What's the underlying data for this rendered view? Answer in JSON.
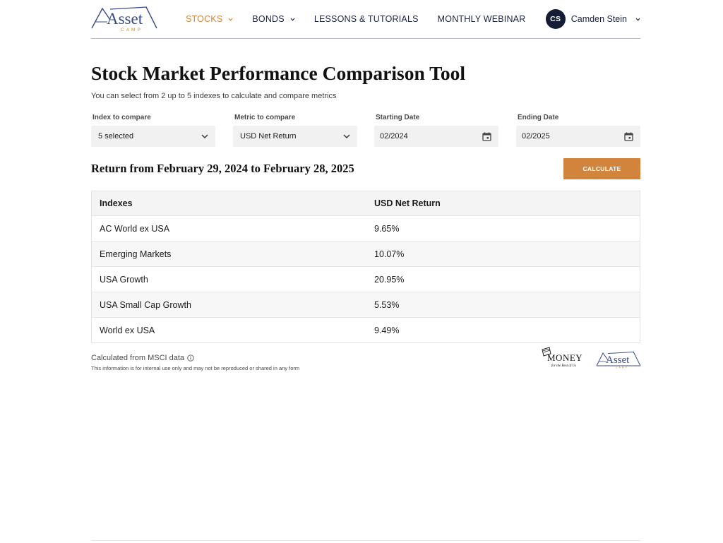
{
  "brand": {
    "logo_text": "Asset",
    "logo_sub": "CAMP",
    "color_primary": "#3a4a8a",
    "color_accent": "#d2843c"
  },
  "nav": {
    "items": [
      {
        "label": "STOCKS",
        "active": true,
        "has_menu": true
      },
      {
        "label": "BONDS",
        "active": false,
        "has_menu": true
      },
      {
        "label": "LESSONS & TUTORIALS",
        "active": false,
        "has_menu": false
      },
      {
        "label": "MONTHLY WEBINAR",
        "active": false,
        "has_menu": false
      }
    ]
  },
  "user": {
    "initials": "CS",
    "name": "Camden Stein"
  },
  "page": {
    "title": "Stock Market Performance Comparison Tool",
    "subtitle": "You can select from 2 up to 5 indexes to calculate and compare metrics"
  },
  "filters": {
    "index": {
      "label": "Index to compare",
      "value": "5 selected"
    },
    "metric": {
      "label": "Metric to compare",
      "value": "USD Net Return"
    },
    "start": {
      "label": "Starting Date",
      "value": "02/2024"
    },
    "end": {
      "label": "Ending Date",
      "value": "02/2025"
    }
  },
  "results": {
    "title": "Return from February 29, 2024 to February 28, 2025",
    "calculate_label": "CALCULATE",
    "columns": [
      "Indexes",
      "USD Net Return"
    ],
    "rows": [
      [
        "AC World ex USA",
        "9.65%"
      ],
      [
        "Emerging Markets",
        "10.07%"
      ],
      [
        "USA Growth",
        "20.95%"
      ],
      [
        "USA Small Cap Growth",
        "5.53%"
      ],
      [
        "World ex USA",
        "9.49%"
      ]
    ]
  },
  "footer": {
    "source": "Calculated from MSCI data",
    "disclaimer": "This information is for internal use only and may not be reproduced or shared in any form",
    "partner_logo_text": "MONEY",
    "partner_logo_tagline": "for the Rest of Us"
  }
}
